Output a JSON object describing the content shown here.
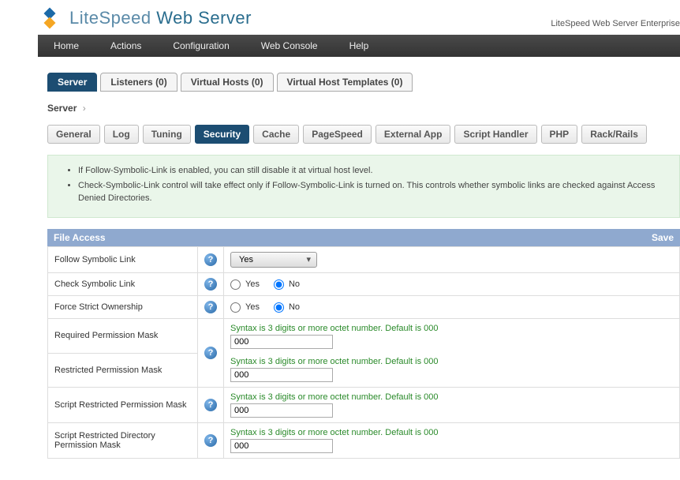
{
  "header": {
    "logo_light": "LiteSpeed",
    "logo_bold": "Web Server",
    "edition": "LiteSpeed Web Server Enterprise"
  },
  "nav": {
    "home": "Home",
    "actions": "Actions",
    "configuration": "Configuration",
    "webconsole": "Web Console",
    "help": "Help"
  },
  "top_tabs": {
    "server": "Server",
    "listeners": "Listeners (0)",
    "vhosts": "Virtual Hosts (0)",
    "vhtemplates": "Virtual Host Templates (0)"
  },
  "breadcrumb": {
    "server": "Server",
    "sep": "›"
  },
  "sub_tabs": {
    "general": "General",
    "log": "Log",
    "tuning": "Tuning",
    "security": "Security",
    "cache": "Cache",
    "pagespeed": "PageSpeed",
    "externalapp": "External App",
    "scripthandler": "Script Handler",
    "php": "PHP",
    "rackrails": "Rack/Rails"
  },
  "notice": {
    "line1": "If Follow-Symbolic-Link is enabled, you can still disable it at virtual host level.",
    "line2": "Check-Symbolic-Link control will take effect only if Follow-Symbolic-Link is turned on. This controls whether symbolic links are checked against Access Denied Directories."
  },
  "section": {
    "title": "File Access",
    "save": "Save"
  },
  "rows": {
    "follow_symlink": {
      "label": "Follow Symbolic Link",
      "value": "Yes"
    },
    "check_symlink": {
      "label": "Check Symbolic Link",
      "yes": "Yes",
      "no": "No"
    },
    "force_strict": {
      "label": "Force Strict Ownership",
      "yes": "Yes",
      "no": "No"
    },
    "req_perm": {
      "label": "Required Permission Mask",
      "hint": "Syntax is 3 digits or more octet number. Default is 000",
      "value": "000"
    },
    "res_perm": {
      "label": "Restricted Permission Mask",
      "hint": "Syntax is 3 digits or more octet number. Default is 000",
      "value": "000"
    },
    "script_res_perm": {
      "label": "Script Restricted Permission Mask",
      "hint": "Syntax is 3 digits or more octet number. Default is 000",
      "value": "000"
    },
    "script_res_dir_perm": {
      "label": "Script Restricted Directory Permission Mask",
      "hint": "Syntax is 3 digits or more octet number. Default is 000",
      "value": "000"
    }
  }
}
